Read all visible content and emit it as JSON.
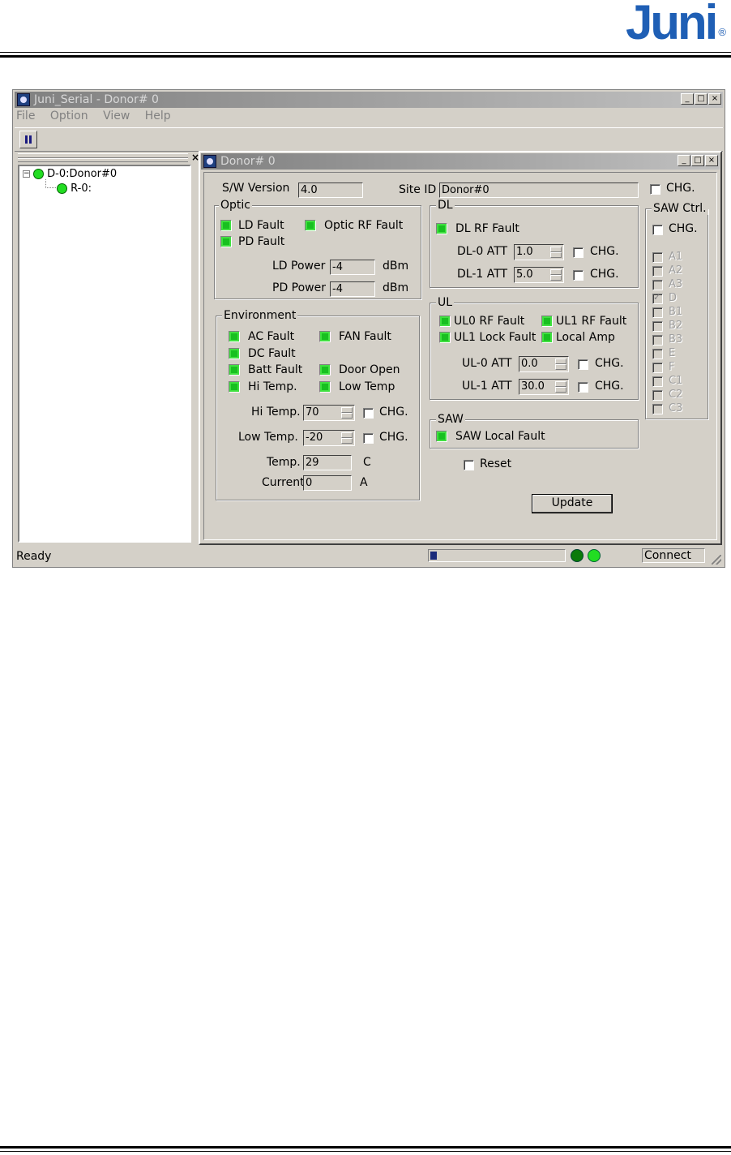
{
  "brand": {
    "logo_text": "Juni",
    "registered": "®"
  },
  "app": {
    "title": "Juni_Serial - Donor# 0",
    "menu": [
      "File",
      "Option",
      "View",
      "Help"
    ],
    "window_controls": {
      "minimize": "_",
      "maximize": "□",
      "close": "×"
    }
  },
  "sidebar": {
    "close": "×",
    "tree": [
      {
        "label": "D-0:Donor#0",
        "expander": "−",
        "status_color": "#22dd22"
      },
      {
        "label": "R-0:",
        "status_color": "#22dd22"
      }
    ]
  },
  "child": {
    "title": "Donor# 0",
    "sw_version": {
      "label": "S/W Version",
      "value": "4.0"
    },
    "site_id": {
      "label": "Site ID",
      "value": "Donor#0",
      "chg": "CHG."
    },
    "optic": {
      "title": "Optic",
      "ld_fault": "LD Fault",
      "optic_rf_fault": "Optic RF Fault",
      "pd_fault": "PD Fault",
      "ld_power": {
        "label": "LD Power",
        "value": "-4",
        "unit": "dBm"
      },
      "pd_power": {
        "label": "PD Power",
        "value": "-4",
        "unit": "dBm"
      }
    },
    "environment": {
      "title": "Environment",
      "ac_fault": "AC Fault",
      "fan_fault": "FAN Fault",
      "dc_fault": "DC Fault",
      "batt_fault": "Batt Fault",
      "door_open": "Door Open",
      "hi_temp_alarm": "Hi Temp.",
      "low_temp_alarm": "Low Temp",
      "hi_temp": {
        "label": "Hi Temp.",
        "value": "70",
        "chg": "CHG."
      },
      "low_temp": {
        "label": "Low Temp.",
        "value": "-20",
        "chg": "CHG."
      },
      "temp": {
        "label": "Temp.",
        "value": "29",
        "unit": "C"
      },
      "current": {
        "label": "Current",
        "value": "0",
        "unit": "A"
      }
    },
    "dl": {
      "title": "DL",
      "rf_fault": "DL RF Fault",
      "att0": {
        "label": "DL-0 ATT",
        "value": "1.0",
        "chg": "CHG."
      },
      "att1": {
        "label": "DL-1 ATT",
        "value": "5.0",
        "chg": "CHG."
      }
    },
    "ul": {
      "title": "UL",
      "ul0_rf_fault": "UL0 RF Fault",
      "ul1_rf_fault": "UL1 RF Fault",
      "ul1_lock_fault": "UL1 Lock Fault",
      "local_amp": "Local Amp",
      "att0": {
        "label": "UL-0 ATT",
        "value": "0.0",
        "chg": "CHG."
      },
      "att1": {
        "label": "UL-1 ATT",
        "value": "30.0",
        "chg": "CHG."
      }
    },
    "saw": {
      "title": "SAW",
      "local_fault": "SAW Local Fault"
    },
    "reset": "Reset",
    "update_button": "Update",
    "saw_ctrl": {
      "title": "SAW Ctrl.",
      "chg": "CHG.",
      "items": [
        {
          "label": "A1",
          "checked": false
        },
        {
          "label": "A2",
          "checked": false
        },
        {
          "label": "A3",
          "checked": false
        },
        {
          "label": "D",
          "checked": true
        },
        {
          "label": "B1",
          "checked": false
        },
        {
          "label": "B2",
          "checked": false
        },
        {
          "label": "B3",
          "checked": false
        },
        {
          "label": "E",
          "checked": false
        },
        {
          "label": "F",
          "checked": false
        },
        {
          "label": "C1",
          "checked": false
        },
        {
          "label": "C2",
          "checked": false
        },
        {
          "label": "C3",
          "checked": false
        }
      ]
    }
  },
  "statusbar": {
    "text": "Ready",
    "progress": 0.05,
    "led_dark": "#0a7a0a",
    "led_bright": "#22dd22",
    "connect": "Connect"
  },
  "colors": {
    "led_green": "#18c020",
    "logo_blue": "#1f5fb5"
  }
}
